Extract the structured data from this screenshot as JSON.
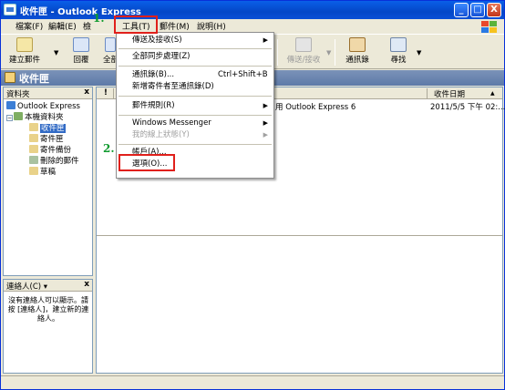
{
  "window": {
    "title": "收件匣 - Outlook Express",
    "min_label": "_",
    "max_label": "□",
    "close_label": "X"
  },
  "menubar": {
    "items": [
      "檔案(F)",
      "編輯(E)",
      "檢",
      "工具(T)",
      "郵件(M)",
      "說明(H)"
    ]
  },
  "toolbar": {
    "create_mail": "建立郵件",
    "reply": "回覆",
    "reply_all": "全部",
    "send_receive": "傳送/接收",
    "addresses": "通訊錄",
    "find": "尋找"
  },
  "folder_header": {
    "title": "收件匣"
  },
  "folders_pane": {
    "header": "資料夾",
    "close": "x",
    "items": [
      "Outlook Express",
      "本機資料夾",
      "收件匣",
      "寄件匣",
      "寄件備份",
      "刪除的郵件",
      "草稿"
    ]
  },
  "contacts_pane": {
    "header": "連絡人(C) ▾",
    "close": "x",
    "message": "沒有連絡人可以顯示。請按 [連絡人]，建立新的連絡人。"
  },
  "message_list": {
    "col_flag": "!",
    "col_date": "收件日期",
    "sort_arrow": "▲",
    "row": {
      "subject": "用 Outlook Express 6",
      "date": "2011/5/5 下午 02:..."
    }
  },
  "tools_menu": {
    "items": [
      {
        "label": "傳送及接收(S)",
        "shortcut": "",
        "submenu": true,
        "disabled": false
      },
      {
        "label": "全部同步處理(Z)",
        "shortcut": "",
        "submenu": false,
        "disabled": false
      },
      {
        "label": "通訊錄(B)...",
        "shortcut": "Ctrl+Shift+B",
        "submenu": false,
        "disabled": false
      },
      {
        "label": "新增寄件者至通訊錄(D)",
        "shortcut": "",
        "submenu": false,
        "disabled": false
      },
      {
        "label": "郵件規則(R)",
        "shortcut": "",
        "submenu": true,
        "disabled": false
      },
      {
        "label": "Windows Messenger",
        "shortcut": "",
        "submenu": true,
        "disabled": false
      },
      {
        "label": "我的線上狀態(Y)",
        "shortcut": "",
        "submenu": true,
        "disabled": true
      },
      {
        "label": "帳戶(A)...",
        "shortcut": "",
        "submenu": false,
        "disabled": false
      },
      {
        "label": "選項(O)...",
        "shortcut": "",
        "submenu": false,
        "disabled": false
      }
    ]
  },
  "annotations": {
    "step1": "1.",
    "step2": "2.",
    "highlight_color": "#e0201b",
    "step_color": "#0d9a2d"
  }
}
